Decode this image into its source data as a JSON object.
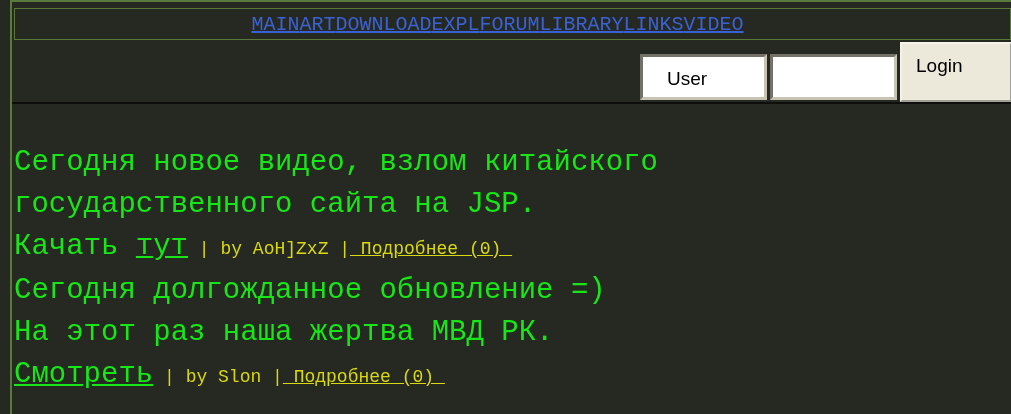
{
  "nav": {
    "links": [
      "MAIN",
      "ART",
      "DOWNLOAD",
      "EXPL",
      "FORUM",
      "LIBRARY",
      "LINKS",
      "VIDEO"
    ]
  },
  "login": {
    "username": "User",
    "button": "Login"
  },
  "posts": [
    {
      "lines": [
        "Сегодня новое видео, взлом китайского",
        "государственного сайта на JSP."
      ],
      "action_prefix": "Качать",
      "action_link": "тут",
      "byline": "| by AoH]ZxZ |",
      "more": " Подробнее (0) "
    },
    {
      "lines": [
        "Сегодня долгожданное обновление =)",
        "На этот раз наша жертва МВД РК."
      ],
      "action_link": "Смотреть",
      "byline": "| by Slon |",
      "more": " Подробнее (0) "
    }
  ]
}
